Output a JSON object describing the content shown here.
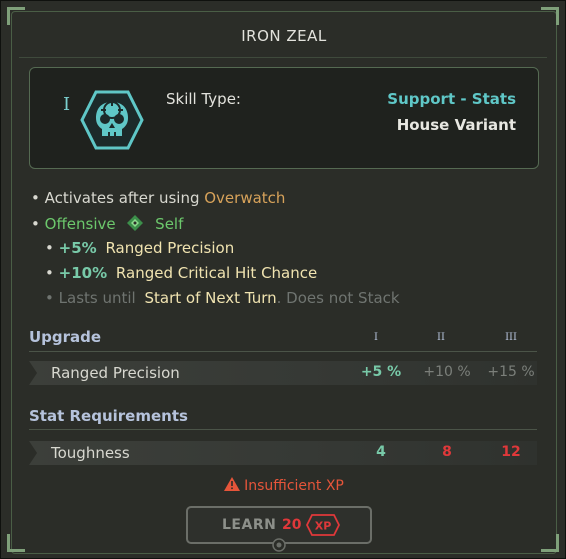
{
  "title": "IRON ZEAL",
  "header": {
    "tier": "I",
    "skill_type_label": "Skill Type:",
    "skill_type_value": "Support - Stats",
    "variant": "House Variant",
    "icon": "skull-crosshair-icon"
  },
  "effects": {
    "activates_prefix": "Activates after using",
    "activates_skill": "Overwatch",
    "tag_offensive": "Offensive",
    "tag_self": "Self",
    "bonus1_value": "+5%",
    "bonus1_label": "Ranged Precision",
    "bonus2_value": "+10%",
    "bonus2_label": "Ranged Critical Hit Chance",
    "duration_prefix": "Lasts until",
    "duration_value": "Start of Next Turn",
    "duration_suffix": ". Does not Stack"
  },
  "upgrade": {
    "heading": "Upgrade",
    "levels": [
      "I",
      "II",
      "III"
    ],
    "row_label": "Ranged Precision",
    "values": [
      "+5 %",
      "+10 %",
      "+15 %"
    ]
  },
  "requirements": {
    "heading": "Stat Requirements",
    "row_label": "Toughness",
    "values": [
      "4",
      "8",
      "12"
    ]
  },
  "warning": "Insufficient XP",
  "learn": {
    "label": "LEARN",
    "cost": "20",
    "currency": "XP"
  },
  "colors": {
    "accent_teal": "#5fc7c7",
    "accent_orange": "#d7a25a",
    "accent_green": "#6cc86c",
    "insufficient_red": "#e0383a"
  }
}
